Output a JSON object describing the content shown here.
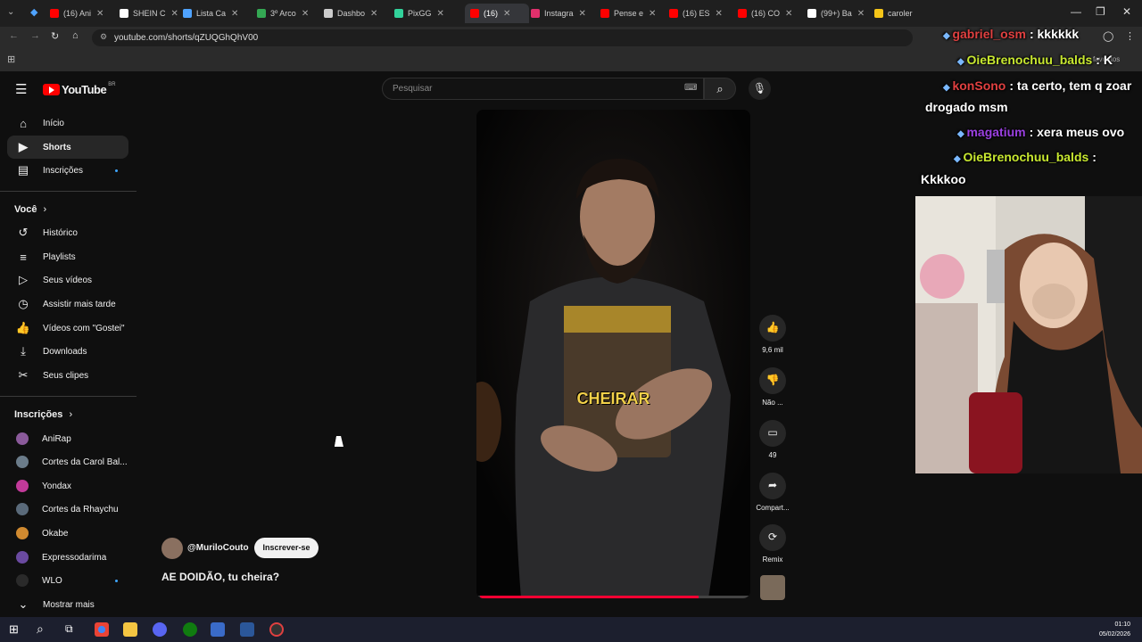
{
  "browser": {
    "tabs": [
      {
        "label": "(16) Ani",
        "color": "#ff0000"
      },
      {
        "label": "SHEIN C",
        "color": "#ffffff"
      },
      {
        "label": "Lista Ca",
        "color": "#4fa3ff"
      },
      {
        "label": "3º Arco",
        "color": "#34a853"
      },
      {
        "label": "Dashbo",
        "color": "#cccccc"
      },
      {
        "label": "PixGG",
        "color": "#32d29b"
      },
      {
        "label": "(16)",
        "color": "#ff0000"
      },
      {
        "label": "Instagra",
        "color": "#e1306c"
      },
      {
        "label": "Pense e",
        "color": "#ff0000"
      },
      {
        "label": "(16) ES",
        "color": "#ff0000"
      },
      {
        "label": "(16) CO",
        "color": "#ff0000"
      },
      {
        "label": "(99+) Ba",
        "color": "#ffffff"
      },
      {
        "label": "caroler",
        "color": "#f5c518"
      }
    ],
    "url": "youtube.com/shorts/qZUQGhQhV00",
    "bookmarks_label": "favoritos"
  },
  "youtube": {
    "logo": "YouTube",
    "region": "BR",
    "search_placeholder": "Pesquisar",
    "sidebar": {
      "main": [
        {
          "label": "Início",
          "icon": "home-icon",
          "glyph": "⌂"
        },
        {
          "label": "Shorts",
          "icon": "shorts-icon",
          "glyph": "▶"
        },
        {
          "label": "Inscrições",
          "icon": "subscriptions-icon",
          "glyph": "▤"
        }
      ],
      "you_heading": "Você",
      "you": [
        {
          "label": "Histórico",
          "icon": "history-icon",
          "glyph": "↺"
        },
        {
          "label": "Playlists",
          "icon": "playlists-icon",
          "glyph": "≡"
        },
        {
          "label": "Seus vídeos",
          "icon": "your-videos-icon",
          "glyph": "▷"
        },
        {
          "label": "Assistir mais tarde",
          "icon": "watch-later-icon",
          "glyph": "◷"
        },
        {
          "label": "Vídeos com \"Gostei\"",
          "icon": "liked-icon",
          "glyph": "👍"
        },
        {
          "label": "Downloads",
          "icon": "downloads-icon",
          "glyph": "⤓"
        },
        {
          "label": "Seus clipes",
          "icon": "clips-icon",
          "glyph": "✂"
        }
      ],
      "subs_heading": "Inscrições",
      "subs": [
        {
          "label": "AniRap",
          "color": "#8a5a9a"
        },
        {
          "label": "Cortes da Carol Bal...",
          "color": "#6b7c8a"
        },
        {
          "label": "Yondax",
          "color": "#c23a9a"
        },
        {
          "label": "Cortes da Rhaychu",
          "color": "#5a6a7a"
        },
        {
          "label": "Okabe",
          "color": "#d08a30"
        },
        {
          "label": "Expressodarima",
          "color": "#6a4aa0"
        },
        {
          "label": "WLO",
          "color": "#2a2a2a"
        }
      ],
      "show_more": "Mostrar mais"
    },
    "short": {
      "caption": "CHEIRAR",
      "channel": "@MuriloCouto",
      "subscribe": "Inscrever-se",
      "title": "AE DOIDÃO, tu cheira?",
      "progress": 0.82,
      "likes": "9,6 mil",
      "dislike": "Não ...",
      "comments": "49",
      "share": "Compart...",
      "remix": "Remix"
    }
  },
  "chat": [
    {
      "user": "gabriel_osm",
      "msg": ": kkkkkk",
      "color": "#e04040"
    },
    {
      "user": "OieBrenochuu_balds",
      "msg": ": K",
      "color": "#c8e830"
    },
    {
      "user": "konSono",
      "msg": ": ta certo, tem q zoar",
      "color": "#e04040"
    },
    {
      "line": "drogado msm"
    },
    {
      "user": "magatium",
      "msg": ": xera meus ovo",
      "color": "#9a40e0"
    },
    {
      "user": "OieBrenochuu_balds",
      "msg": ":",
      "color": "#c8e830"
    },
    {
      "line": "Kkkkoo"
    }
  ],
  "taskbar": {
    "time": "01:10",
    "date": "05/02/2026"
  }
}
